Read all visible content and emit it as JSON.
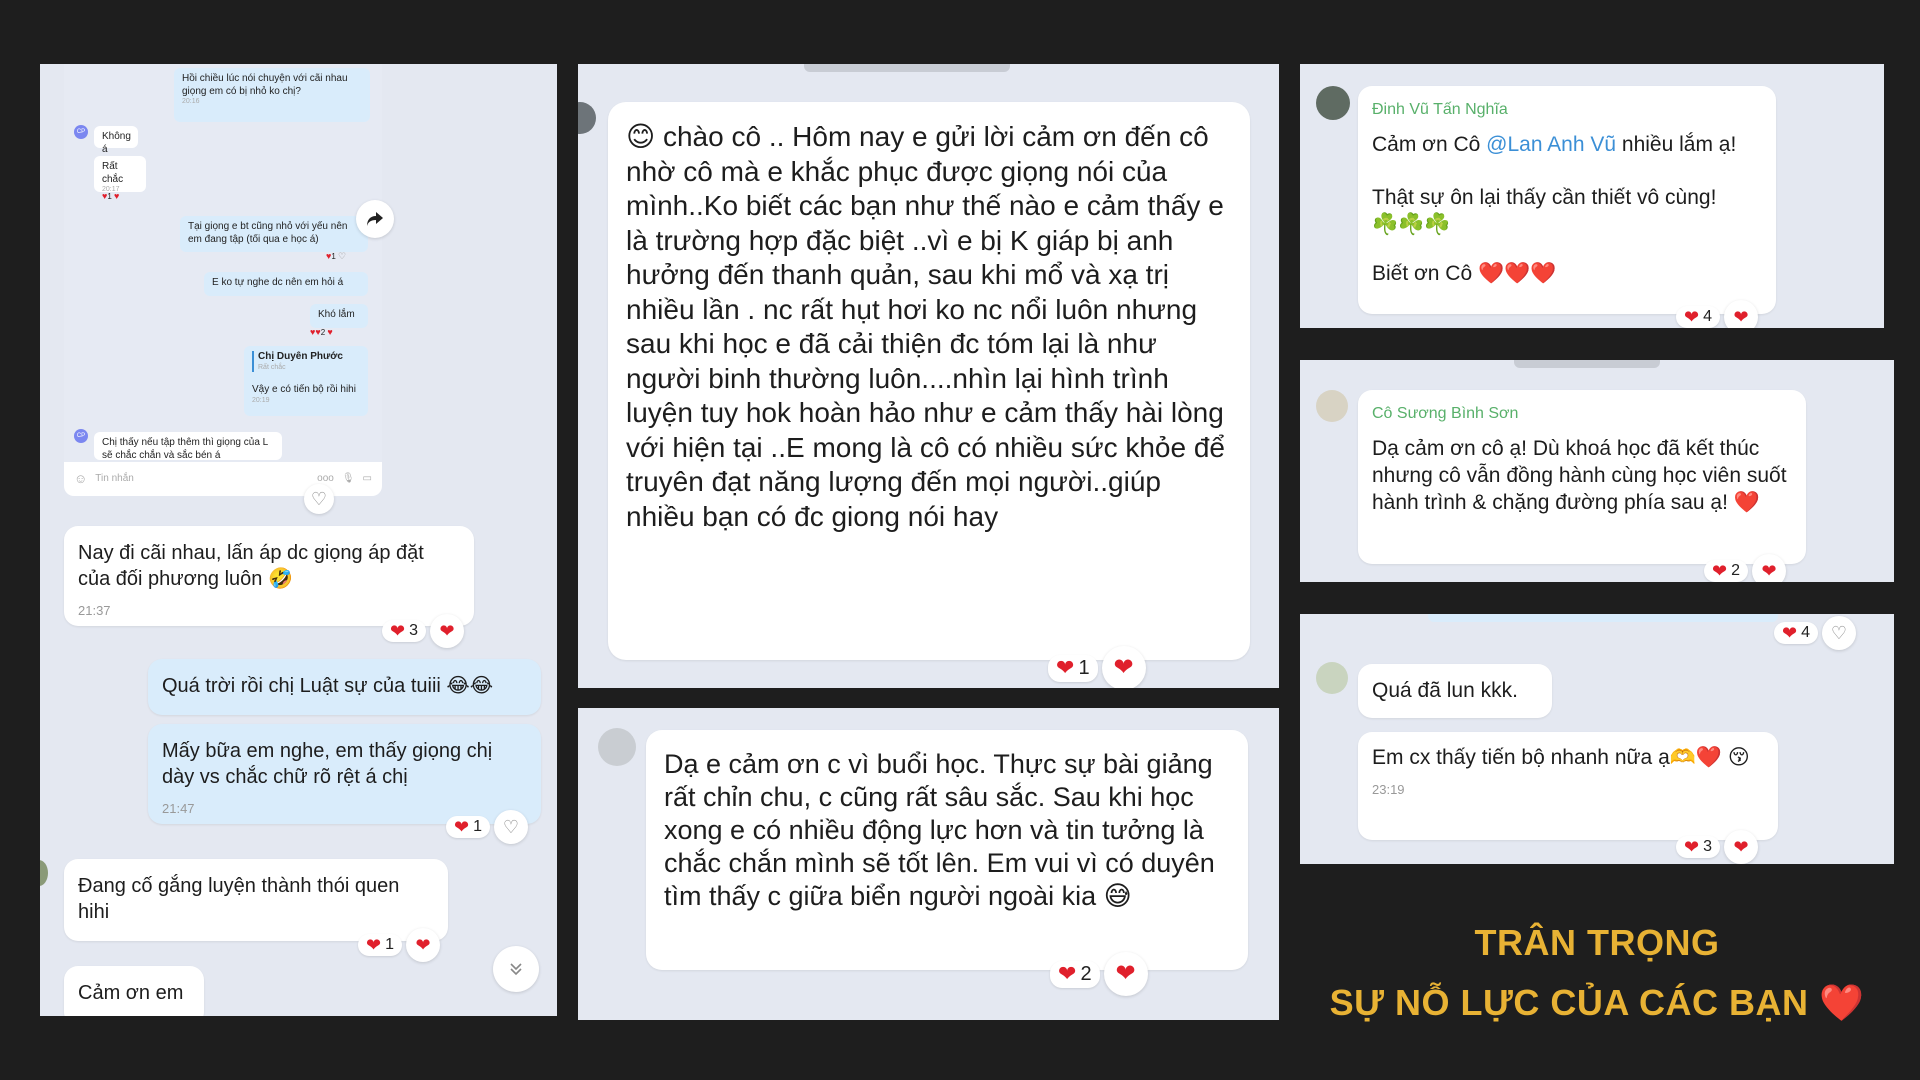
{
  "panel1": {
    "screenshot": {
      "m1": "Hồi chiều lúc nói chuyện với cãi nhau giọng em có bị nhỏ ko chị?",
      "t1": "20:16",
      "m2": "Không á",
      "m3": "Rất chắc",
      "t3": "20:17",
      "m4": "Tại giọng e bt cũng nhỏ với yếu nên em đang tập (tối qua e học á)",
      "m5": "E ko tự nghe dc nên em hỏi á",
      "m6": "Khó lắm",
      "quote_name": "Chị Duyên Phước",
      "quote_text": "Rất chắc",
      "m7": "Vậy e có tiến bộ rồi hihi",
      "t7": "20:19",
      "m8": "Chị thấy nếu tập thêm thì giọng của L sẽ chắc chắn và sắc bén á",
      "input_placeholder": "Tin nhắn",
      "more": "ooo",
      "avatar_initials": "CP",
      "counts": [
        "1",
        "1",
        "2"
      ]
    },
    "msg1": {
      "text": "Nay đi cãi nhau,  lấn áp dc giọng áp đặt của đối phương luôn 🤣",
      "time": "21:37",
      "count": "3"
    },
    "msg2": {
      "text": "Quá trời rồi chị Luật sự của tuiii 😂😂"
    },
    "msg3": {
      "text": "Mấy bữa em nghe, em thấy giọng chị dày vs chắc chữ rõ rệt á chị",
      "time": "21:47",
      "count": "1"
    },
    "msg4": {
      "text": "Đang cố gắng luyện thành thói quen hihi",
      "count": "1"
    },
    "msg5": {
      "text": "Cảm ơn em"
    }
  },
  "panel2": {
    "text": "😊 chào cô .. Hôm nay e gửi lời cảm ơn đến cô nhờ cô mà e khắc phục được giọng nói của mình..Ko biết các bạn như thế nào e cảm thấy e là trường hợp đặc biệt ..vì e bị K giáp bị anh hưởng đến thanh quản, sau khi mổ và xạ trị nhiều lần . nc rất hụt hơi ko nc nổi luôn nhưng sau khi học e đã cải thiện đc tóm lại là như người binh thường luôn....nhìn lại hình trình luyện tuy hok hoàn hảo như e cảm thấy hài lòng với hiện tại ..E mong là cô có nhiều sức khỏe để truyên đạt năng lượng đến mọi người..giúp nhiều bạn có đc giong nói hay",
    "count": "1"
  },
  "panel3": {
    "text": "Dạ e cảm ơn c vì buổi học. Thực sự bài giảng rất chỉn chu, c cũng rất sâu sắc. Sau khi học xong e có nhiều động lực hơn và tin tưởng là chắc chắn mình sẽ tốt lên. Em vui vì có duyên tìm thấy c giữa biển người ngoài kia 😅",
    "count": "2"
  },
  "panel4": {
    "name": "Đinh Vũ Tấn Nghĩa",
    "line1_pre": "Cảm ơn Cô ",
    "mention": "@Lan Anh Vũ",
    "line1_post": " nhiều lắm ạ!",
    "line2": "Thật sự ôn lại thấy cần thiết vô cùng!",
    "line3": "☘️☘️☘️",
    "line4": "Biết ơn Cô ❤️❤️❤️",
    "count": "4"
  },
  "panel5": {
    "name": "Cô Sương Bình Sơn",
    "text": "Dạ cảm ơn cô ạ! Dù khoá học đã kết thúc nhưng cô vẫn đồng hành cùng học viên suốt hành trình & chặng đường phía sau ạ! ❤️",
    "count": "2"
  },
  "panel6": {
    "top_count": "4",
    "msg1": "Quá đã lun kkk.",
    "msg2": "Em cx thấy tiến bộ nhanh nữa ạ🫶❤️ 😚",
    "time": "23:19",
    "count": "3"
  },
  "footer": {
    "line1": "TRÂN TRỌNG",
    "line2": "SỰ NỖ LỰC CỦA CÁC BẠN ❤️"
  },
  "colors": {
    "background": "#1e1e1e",
    "panel": "#e4e8f1",
    "heart": "#e0202c",
    "accent_gold": "#e8b234",
    "name_green": "#58b06a",
    "mention_blue": "#3b8fd6"
  },
  "icons": [
    "share-arrow-icon",
    "heart-icon",
    "heart-outline-icon",
    "scroll-down-icon",
    "sticker-icon",
    "mic-icon",
    "image-icon"
  ]
}
